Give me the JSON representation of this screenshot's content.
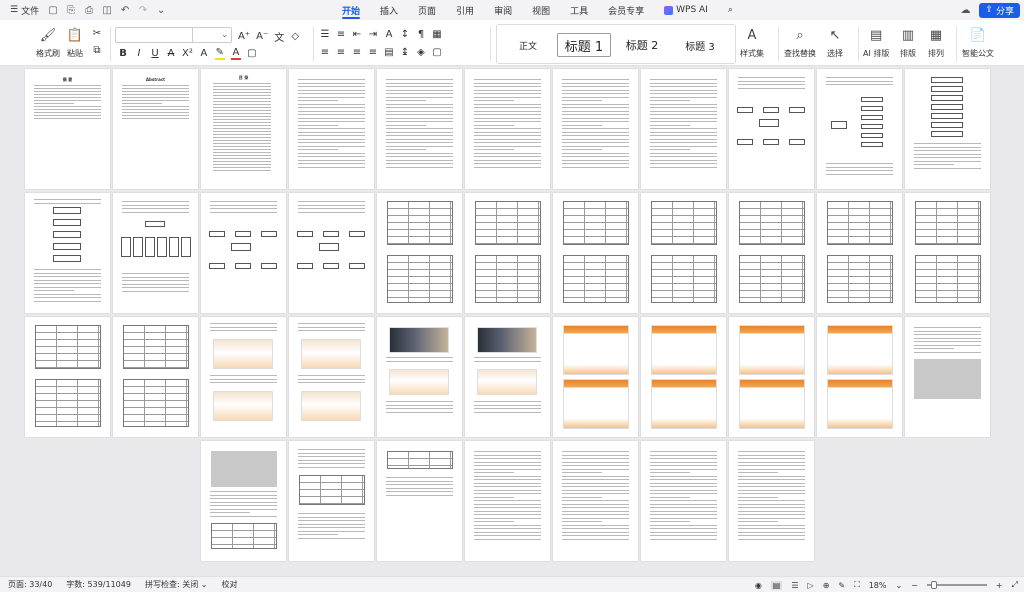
{
  "app": {
    "file_menu": "文件",
    "tabs": [
      "开始",
      "插入",
      "页面",
      "引用",
      "审阅",
      "视图",
      "工具",
      "会员专享"
    ],
    "ai_tab": "WPS AI",
    "share_label": "分享"
  },
  "ribbon": {
    "format_painter": "格式刷",
    "paste": "粘贴",
    "font_name": "",
    "font_size": "",
    "styles": [
      "正文",
      "标题 1",
      "标题 2",
      "标题 3"
    ],
    "style_set": "样式集",
    "find_replace": "查找替换",
    "select": "选择",
    "ai_layout": "AI 排版",
    "layout": "排版",
    "arrange": "排列",
    "smart_doc": "智能公文"
  },
  "status": {
    "page": "页面: 33/40",
    "words": "字数: 539/11049",
    "spellcheck": "拼写检查: 关闭",
    "proofread": "校对",
    "zoom": "18%",
    "zoom_level": 0.18
  },
  "pages": {
    "p1_title": "摘  要",
    "p2_title": "Abstract",
    "p3_title": "目  录",
    "p12_title": "第 1 章  绪论"
  },
  "icons": {
    "menu": "hamburger-icon",
    "search": "search-icon",
    "share": "share-icon",
    "cloud": "cloud-icon"
  },
  "colors": {
    "accent": "#1a5de8",
    "doc_bg": "#e9e9eb"
  }
}
